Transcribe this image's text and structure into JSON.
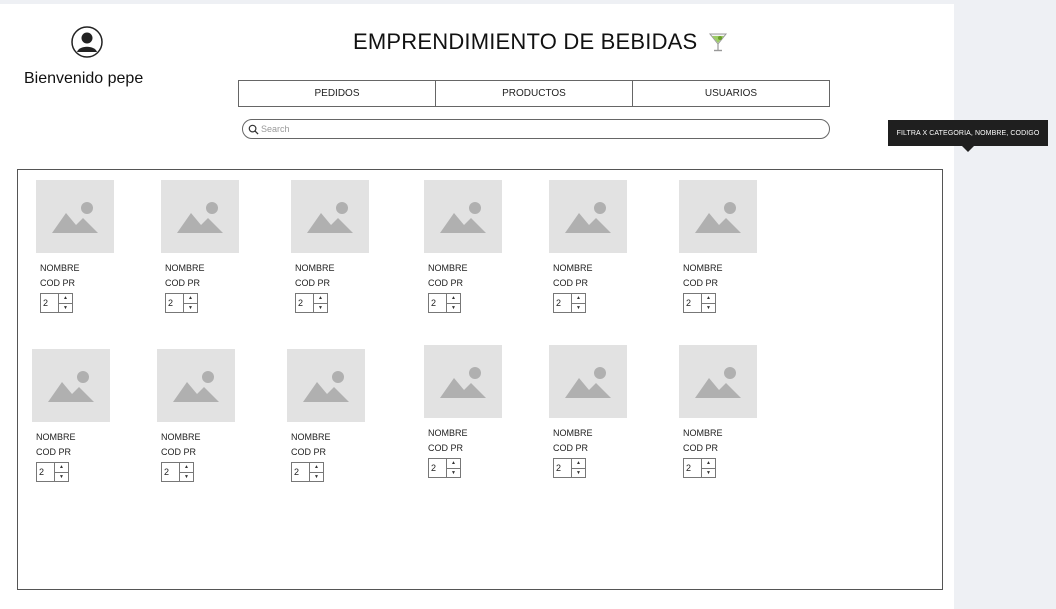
{
  "header": {
    "welcome_text": "Bienvenido pepe",
    "title": "EMPRENDIMIENTO DE BEBIDAS",
    "title_icon": "cocktail-glass-icon",
    "avatar_icon": "user-avatar-icon"
  },
  "nav": {
    "tabs": [
      {
        "label": "PEDIDOS"
      },
      {
        "label": "PRODUCTOS"
      },
      {
        "label": "USUARIOS"
      }
    ]
  },
  "search": {
    "placeholder": "Search",
    "value": "",
    "icon": "search-icon"
  },
  "tooltip": {
    "text": "FILTRA X CATEGORIA, NOMBRE, CODIGO"
  },
  "products": [
    {
      "name": "NOMBRE",
      "code": "COD PR",
      "quantity": "2",
      "icon": "image-placeholder-icon"
    },
    {
      "name": "NOMBRE",
      "code": "COD PR",
      "quantity": "2",
      "icon": "image-placeholder-icon"
    },
    {
      "name": "NOMBRE",
      "code": "COD PR",
      "quantity": "2",
      "icon": "image-placeholder-icon"
    },
    {
      "name": "NOMBRE",
      "code": "COD PR",
      "quantity": "2",
      "icon": "image-placeholder-icon"
    },
    {
      "name": "NOMBRE",
      "code": "COD PR",
      "quantity": "2",
      "icon": "image-placeholder-icon"
    },
    {
      "name": "NOMBRE",
      "code": "COD PR",
      "quantity": "2",
      "icon": "image-placeholder-icon"
    },
    {
      "name": "NOMBRE",
      "code": "COD PR",
      "quantity": "2",
      "icon": "image-placeholder-icon"
    },
    {
      "name": "NOMBRE",
      "code": "COD PR",
      "quantity": "2",
      "icon": "image-placeholder-icon"
    },
    {
      "name": "NOMBRE",
      "code": "COD PR",
      "quantity": "2",
      "icon": "image-placeholder-icon"
    },
    {
      "name": "NOMBRE",
      "code": "COD PR",
      "quantity": "2",
      "icon": "image-placeholder-icon"
    },
    {
      "name": "NOMBRE",
      "code": "COD PR",
      "quantity": "2",
      "icon": "image-placeholder-icon"
    },
    {
      "name": "NOMBRE",
      "code": "COD PR",
      "quantity": "2",
      "icon": "image-placeholder-icon"
    }
  ],
  "colors": {
    "background": "#eef0f4",
    "canvas": "#ffffff",
    "placeholder": "#e2e2e2",
    "placeholder_shape": "#b0b0b0",
    "tooltip": "#1f1f1f"
  }
}
